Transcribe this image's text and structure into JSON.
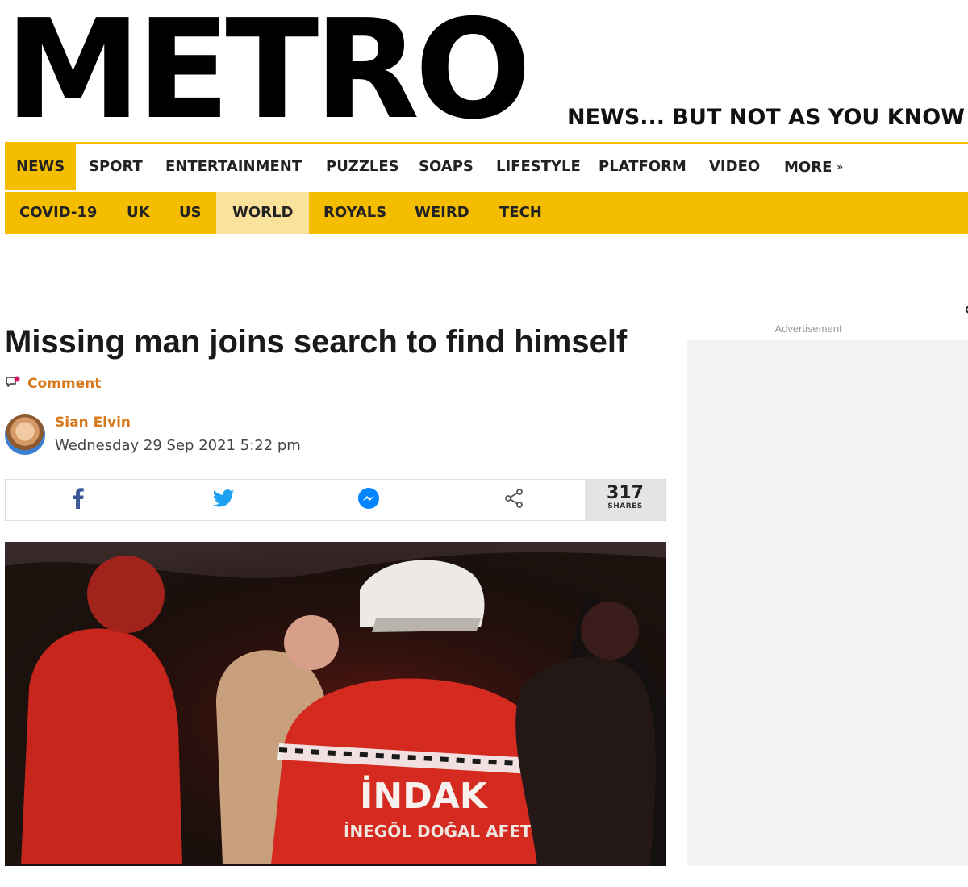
{
  "masthead": {
    "logo": "METRO",
    "tagline": "NEWS... BUT NOT AS YOU KNOW"
  },
  "nav_primary": {
    "items": [
      {
        "label": "NEWS",
        "active": true
      },
      {
        "label": "SPORT"
      },
      {
        "label": "ENTERTAINMENT"
      },
      {
        "label": "PUZZLES"
      },
      {
        "label": "SOAPS"
      },
      {
        "label": "LIFESTYLE"
      },
      {
        "label": "PLATFORM"
      },
      {
        "label": "VIDEO"
      },
      {
        "label": "MORE"
      }
    ],
    "more_icon": "chevron-double-down-icon"
  },
  "nav_secondary": {
    "items": [
      {
        "label": "COVID-19"
      },
      {
        "label": "UK"
      },
      {
        "label": "US"
      },
      {
        "label": "WORLD",
        "active": true
      },
      {
        "label": "ROYALS"
      },
      {
        "label": "WEIRD"
      },
      {
        "label": "TECH"
      }
    ]
  },
  "article": {
    "headline": "Missing man joins search to find himself",
    "comment_label": "Comment",
    "author": "Sian Elvin",
    "date": "Wednesday 29 Sep 2021 5:22 pm",
    "share": {
      "icons": [
        "facebook-icon",
        "twitter-icon",
        "messenger-icon",
        "share-icon"
      ],
      "count": "317",
      "count_label": "SHARES"
    },
    "photo": {
      "jacket_text": "İNDAK",
      "jacket_subtext": "İNEGÖL DOĞAL AFETLER"
    }
  },
  "sidebar": {
    "ad_label": "Advertisement"
  },
  "colors": {
    "brand_yellow": "#f4bd00",
    "active_subnav": "#fbe29a",
    "accent_orange": "#d7791b",
    "facebook": "#3b5998",
    "twitter": "#1da1f2",
    "messenger": "#0084ff"
  }
}
